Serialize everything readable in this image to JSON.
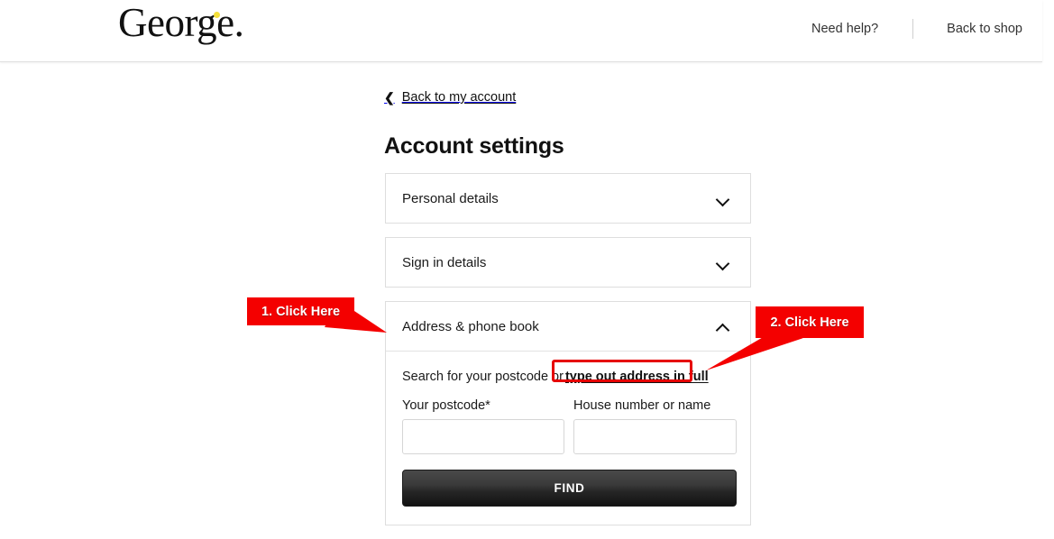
{
  "header": {
    "brand": "George.",
    "brand_accent_color": "#f5e03a",
    "links": [
      {
        "name": "need-help",
        "label": "Need help?"
      },
      {
        "name": "back-to-shop",
        "label": "Back to shop"
      }
    ]
  },
  "page": {
    "back_link": "Back to my account",
    "back_chevron": "chevron-left-icon",
    "title": "Account settings"
  },
  "accordion": {
    "panels": [
      {
        "label": "Personal details",
        "expanded": false,
        "icon": "chevron-down-icon"
      },
      {
        "label": "Sign in details",
        "expanded": false,
        "icon": "chevron-down-icon"
      },
      {
        "label": "Address & phone book",
        "expanded": true,
        "icon": "chevron-up-icon"
      }
    ]
  },
  "address_form": {
    "search_prefix": "Search for your postcode or",
    "search_link": "type out address in full",
    "postcode": {
      "label": "Your postcode*",
      "value": "",
      "placeholder": ""
    },
    "house": {
      "label": "House number or name",
      "value": "",
      "placeholder": ""
    },
    "find_button": "FIND"
  },
  "annotations": {
    "accent_color": "#f40000",
    "highlight_color": "#e60000",
    "callouts": [
      {
        "label": "1. Click Here",
        "target": "address-phone-book-panel-header"
      },
      {
        "label": "2. Click Here",
        "target": "type-out-address-link"
      }
    ]
  }
}
